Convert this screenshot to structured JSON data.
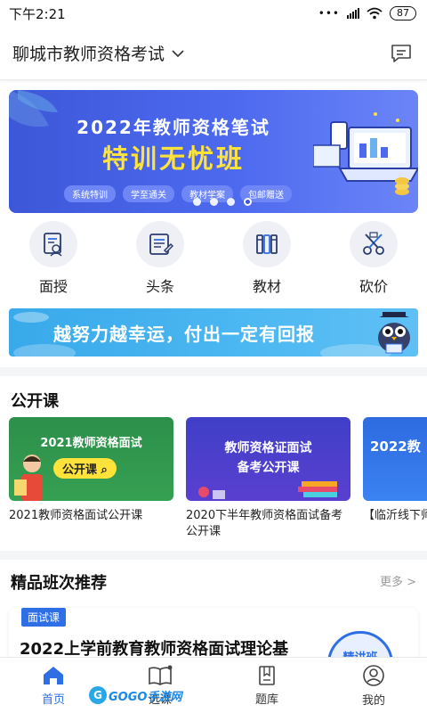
{
  "status_bar": {
    "time": "下午2:21",
    "battery": "87"
  },
  "header": {
    "location": "聊城市教师资格考试",
    "dropdown_icon": "chevron-down-icon",
    "message_icon": "message-icon"
  },
  "banner": {
    "title": "2022年教师资格笔试",
    "subtitle": "特训无忧班",
    "tags": [
      "系统特训",
      "学至通关",
      "教材学案",
      "包邮赠送"
    ],
    "slide_count": 4,
    "active_slide": 4,
    "color": "#4d6aef"
  },
  "quick_nav": [
    {
      "label": "面授",
      "icon": "face-teaching-icon"
    },
    {
      "label": "头条",
      "icon": "headline-icon"
    },
    {
      "label": "教材",
      "icon": "books-icon"
    },
    {
      "label": "砍价",
      "icon": "bargain-icon"
    }
  ],
  "motto": {
    "text": "越努力越幸运，付出一定有回报"
  },
  "public_lessons": {
    "title": "公开课",
    "courses": [
      {
        "thumb_title": "2021教师资格面试",
        "thumb_pill": "公开课",
        "title": "2021教师资格面试公开课"
      },
      {
        "thumb_title_1": "教师资格证面试",
        "thumb_title_2": "备考公开课",
        "title": "2020下半年教师资格面试备考公开课"
      },
      {
        "thumb_title": "2022教",
        "title": "【临沂线下师招考辅导"
      }
    ]
  },
  "recommended": {
    "title": "精品班次推荐",
    "more": "更多 >",
    "card": {
      "badge": "面试课",
      "title": "2022上学前教育教师资格面试理论基",
      "seal": "精讲班"
    }
  },
  "bottom_nav": [
    {
      "label": "首页",
      "icon": "home-icon",
      "active": true
    },
    {
      "label": "选课",
      "icon": "book-open-icon",
      "active": false
    },
    {
      "label": "题库",
      "icon": "question-bank-icon",
      "active": false
    },
    {
      "label": "我的",
      "icon": "user-icon",
      "active": false
    }
  ],
  "watermark": {
    "logo": "G",
    "text": "GOGO手游网"
  },
  "colors": {
    "accent": "#2f6fe6",
    "banner_blue": "#4d6aef",
    "motto_blue": "#4db8f2",
    "highlight_yellow": "#ffe23a"
  }
}
